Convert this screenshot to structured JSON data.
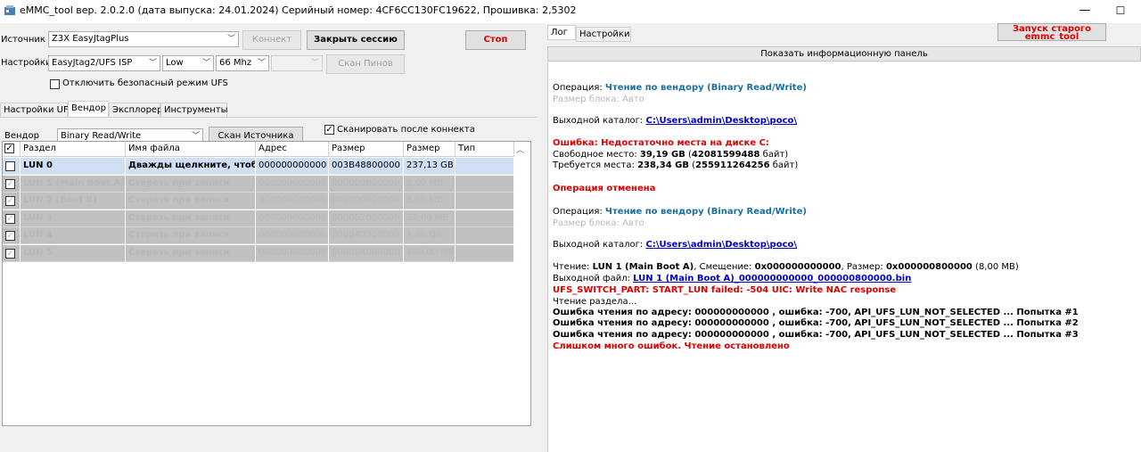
{
  "window": {
    "title": "eMMC_tool вер. 2.0.2.0 (дата выпуска: 24.01.2024) Серийный номер: 4CF6CC130FC19622, Прошивка: 2,5302",
    "minimize": "—",
    "maximize": "☐"
  },
  "source": {
    "label": "Источник",
    "value": "Z3X EasyJtagPlus"
  },
  "buttons": {
    "connect": "Коннект",
    "close_session": "Закрыть сессию",
    "stop": "Стоп",
    "scan_pins": "Скан Пинов",
    "scan_source": "Скан Источника"
  },
  "settings": {
    "label": "Настройки",
    "mode": "EasyJtag2/UFS ISP",
    "level": "Low",
    "freq": "66 Mhz",
    "extra": ""
  },
  "safe_mode_label": "Отключить безопасный режим UFS",
  "tabs": [
    "Настройки UFS",
    "Вендор",
    "Эксплорер",
    "Инструменты"
  ],
  "vendor": {
    "label": "Вендор",
    "value": "Binary Read/Write",
    "scan_after_connect": "Сканировать после коннекта"
  },
  "grid": {
    "headers": [
      "Раздел",
      "Имя файла",
      "Адрес",
      "Размер",
      "Размер",
      "Тип"
    ],
    "rows": [
      {
        "checked": false,
        "name": "LUN 0",
        "file": "Дважды щелкните, чтобы д",
        "addr": "000000000000",
        "size_hex": "003B48800000",
        "size": "237,13 GB",
        "type": ""
      },
      {
        "checked": true,
        "name": "LUN 1 (Main Boot A)",
        "file": "Стереть при записи",
        "addr": "000000000000",
        "size_hex": "000000800000",
        "size": "8,00 MB",
        "type": ""
      },
      {
        "checked": true,
        "name": "LUN 2 (Boot B)",
        "file": "Стереть при записи",
        "addr": "000000000000",
        "size_hex": "000000800000",
        "size": "8,00 MB",
        "type": ""
      },
      {
        "checked": true,
        "name": "LUN 3",
        "file": "Стереть при записи",
        "addr": "000000000000",
        "size_hex": "000002000000",
        "size": "32,00 MB",
        "type": ""
      },
      {
        "checked": true,
        "name": "LUN 4",
        "file": "Стереть при записи",
        "addr": "000000000000",
        "size_hex": "000040000000",
        "size": "1,00 GB",
        "type": ""
      },
      {
        "checked": true,
        "name": "LUN 5",
        "file": "Стереть при записи",
        "addr": "000000000000",
        "size_hex": "00000A000000",
        "size": "160,00 MB",
        "type": ""
      }
    ]
  },
  "right": {
    "tabs": [
      "Лог",
      "Настройки"
    ],
    "old_launch": "Запуск старого emmc_tool",
    "info_bar": "Показать информационную панель"
  },
  "log": {
    "op1_prefix": "Операция: ",
    "op1_value": "Чтение по вендору (Binary Read/Write)",
    "block1": "Размер блока: Авто",
    "outdir1_prefix": "Выходной каталог: ",
    "outdir1_value": "C:\\Users\\admin\\Desktop\\poco\\",
    "err_space": "Ошибка: Недостаточно места на диске C:",
    "free_prefix": "Свободное место: ",
    "free_value": "39,19 GB",
    "free_paren_open": " (",
    "free_bytes": "42081599488",
    "free_paren_close": " байт)",
    "need_prefix": "Требуется места: ",
    "need_value": "238,34 GB",
    "need_paren_open": " (",
    "need_bytes": "255911264256",
    "need_paren_close": " байт)",
    "cancelled": "Операция отменена",
    "op2_prefix": "Операция: ",
    "op2_value": "Чтение по вендору (Binary Read/Write)",
    "block2": "Размер блока: Авто",
    "outdir2_prefix": "Выходной каталог: ",
    "outdir2_value": "C:\\Users\\admin\\Desktop\\poco\\",
    "read_prefix": "Чтение: ",
    "read_lun": "LUN 1 (Main Boot A)",
    "read_offset_label": ", Смещение: ",
    "read_offset": "0x000000000000",
    "read_size_label": ", Размер: ",
    "read_size": "0x000000800000",
    "read_size_human": " (8,00 MB)",
    "outfile_prefix": "Выходной файл: ",
    "outfile_value": "LUN 1 (Main Boot A)_000000000000_000000800000.bin",
    "ufs_error": "UFS_SWITCH_PART: START_LUN failed: -504 UIC: Write NAC response",
    "reading": "Чтение раздела...",
    "err1": "Ошибка чтения по адресу: 000000000000 , ошибка: -700, API_UFS_LUN_NOT_SELECTED ... Попытка #1",
    "err2": "Ошибка чтения по адресу: 000000000000 , ошибка: -700, API_UFS_LUN_NOT_SELECTED ... Попытка #2",
    "err3": "Ошибка чтения по адресу: 000000000000 , ошибка: -700, API_UFS_LUN_NOT_SELECTED ... Попытка #3",
    "too_many": "Слишком много ошибок. Чтение остановлено"
  }
}
